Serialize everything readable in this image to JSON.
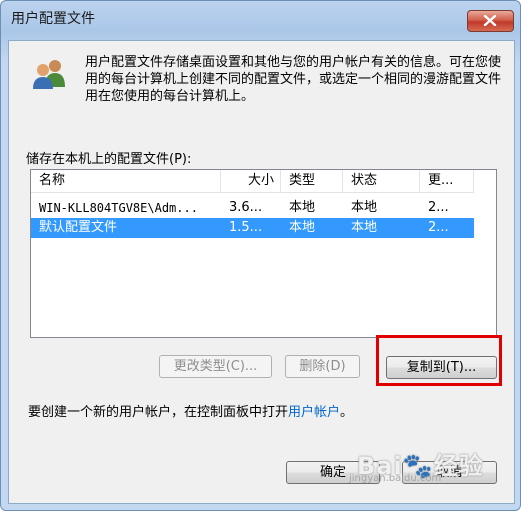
{
  "window": {
    "title": "用户配置文件",
    "close_glyph": "✕"
  },
  "description": "用户配置文件存储桌面设置和其他与您的用户帐户有关的信息。可在您使用的每台计算机上创建不同的配置文件，或选定一个相同的漫游配置文件用在您使用的每台计算机上。",
  "profiles": {
    "label": "储存在本机上的配置文件(P):",
    "columns": [
      "名称",
      "大小",
      "类型",
      "状态",
      "更..."
    ],
    "rows": [
      {
        "name": "WIN-KLL804TGV8E\\Adm...",
        "size": "3.6...",
        "type": "本地",
        "status": "本地",
        "modified": "2..."
      },
      {
        "name": "默认配置文件",
        "size": "1.5...",
        "type": "本地",
        "status": "本地",
        "modified": "2..."
      }
    ]
  },
  "buttons": {
    "change_type": "更改类型(C)...",
    "delete": "删除(D)",
    "copy_to": "复制到(T)...",
    "ok": "确定",
    "cancel": "取消"
  },
  "footer": {
    "text": "要创建一个新的用户帐户，在控制面板中打开",
    "link": "用户帐户",
    "end": "。"
  },
  "watermark": {
    "logo": "Bai🐾经验",
    "url": "jingyan.baidu.com"
  },
  "colors": {
    "selection": "#3399ff",
    "highlight_box": "#e00000",
    "link": "#0066cc"
  }
}
